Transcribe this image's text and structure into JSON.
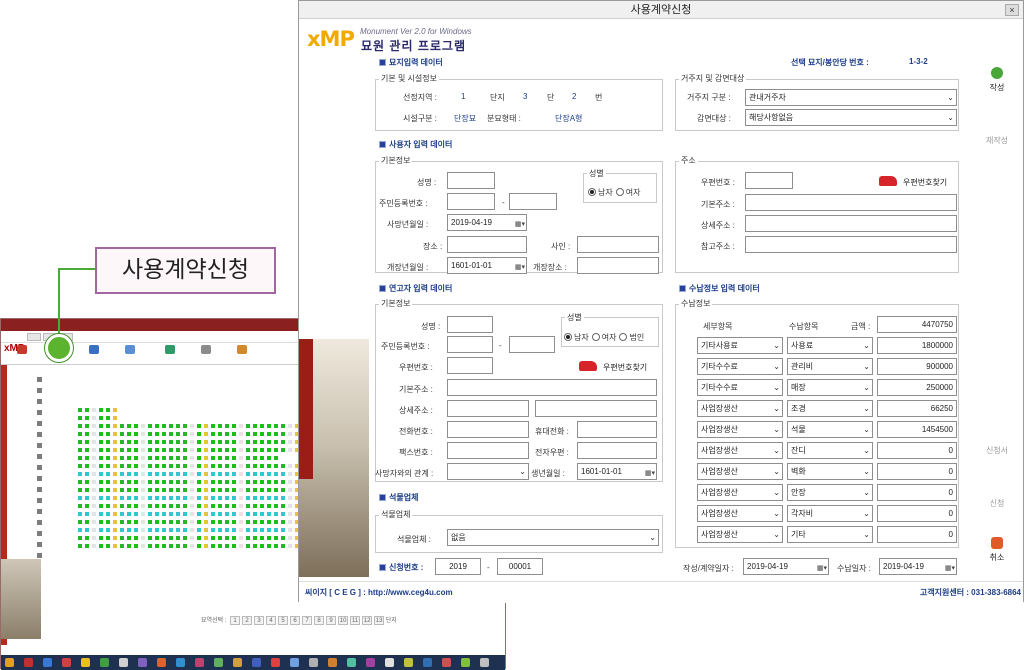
{
  "dialog": {
    "title": "사용계약신청",
    "close_label": "×",
    "brand": {
      "logo": "xMP",
      "version": "Monument Ver 2.0 for Windows",
      "program_name": "묘원 관리 프로그램"
    },
    "selected_grave_label": "선택 묘지/봉안당 번호 :",
    "selected_grave_value": "1-3-2"
  },
  "grave": {
    "section_title": "묘지입력 데이터",
    "facility": {
      "title": "기본 및 시설정보",
      "region_label": "선정지역 :",
      "region_value": "1",
      "danji_label": "단지",
      "danji_value": "3",
      "dan_label": "단",
      "dan_value": "2",
      "bun_label": "번",
      "facility_type_label": "시설구분 :",
      "facility_type_value": "단장묘",
      "burial_type_label": "분묘형태 :",
      "burial_type_value": "단장A형"
    },
    "residency": {
      "title": "거주지 및 감면대상",
      "residence_label": "거주지 구분 :",
      "residence_value": "관내거주자",
      "reduction_label": "감면대상 :",
      "reduction_value": "해당사항없음"
    }
  },
  "user": {
    "section_title": "사용자 입력 데이터",
    "basic": {
      "title": "기본정보",
      "name_label": "성명 :",
      "name_value": "",
      "resident_no_label": "주민등록번호 :",
      "resident_no_dash": "-",
      "gender_title": "성별",
      "male_label": "남자",
      "female_label": "여자",
      "death_date_label": "사망년월일 :",
      "death_date_value": "2019-04-19",
      "funeral_place_label": "장소 :",
      "cause_label": "사인 :",
      "relocation_date_label": "개장년월일 :",
      "relocation_date_value": "1601-01-01",
      "relocation_place_label": "개장장소 :"
    },
    "address": {
      "title": "주소",
      "zip_label": "우편번호 :",
      "zip_button": "우편번호찾기",
      "basic_addr_label": "기본주소 :",
      "detail_addr_label": "상세주소 :",
      "ref_addr_label": "참고주소 :"
    }
  },
  "applicant": {
    "section_title": "연고자 입력 데이터",
    "basic": {
      "title": "기본정보",
      "name_label": "성명 :",
      "resident_no_label": "주민등록번호 :",
      "resident_no_dash": "-",
      "gender_title": "성별",
      "male_label": "남자",
      "female_label": "여자",
      "corp_label": "법인",
      "zip_label": "우편번호 :",
      "zip_button": "우편번호찾기",
      "basic_addr_label": "기본주소 :",
      "detail_addr_label": "상세주소 :",
      "phone_label": "전화번호 :",
      "mobile_label": "휴대전화 :",
      "fax_label": "팩스번호 :",
      "email_label": "전자우편 :",
      "relation_label": "사망자와의 관계 :",
      "relation_value": "",
      "birth_label": "생년월일 :",
      "birth_value": "1601-01-01"
    }
  },
  "stone": {
    "section_title": "석물업체",
    "panel_title": "석물업체",
    "company_label": "석물업체 :",
    "company_value": "없음"
  },
  "payment": {
    "section_title": "수납정보 입력 데이터",
    "panel_title": "수납정보",
    "col_detail": "세부항목",
    "col_item": "수납항목",
    "col_amount": "금액 :",
    "total": "4470750",
    "rows": [
      {
        "detail": "기타사용료",
        "item": "사용료",
        "amount": "1800000"
      },
      {
        "detail": "기타수수료",
        "item": "관리비",
        "amount": "900000"
      },
      {
        "detail": "기타수수료",
        "item": "매장",
        "amount": "250000"
      },
      {
        "detail": "사업장생산",
        "item": "조경",
        "amount": "66250"
      },
      {
        "detail": "사업장생산",
        "item": "석물",
        "amount": "1454500"
      },
      {
        "detail": "사업장생산",
        "item": "잔디",
        "amount": "0"
      },
      {
        "detail": "사업장생산",
        "item": "벽화",
        "amount": "0"
      },
      {
        "detail": "사업장생산",
        "item": "안장",
        "amount": "0"
      },
      {
        "detail": "사업장생산",
        "item": "각자비",
        "amount": "0"
      },
      {
        "detail": "사업장생산",
        "item": "기타",
        "amount": "0"
      }
    ]
  },
  "application_no": {
    "label": "신청번호 :",
    "year": "2019",
    "dash": "-",
    "seq": "00001"
  },
  "dates": {
    "contract_label": "작성/계약일자 :",
    "contract_value": "2019-04-19",
    "receipt_label": "수납일자 :",
    "receipt_value": "2019-04-19"
  },
  "side_buttons": {
    "write": "작성",
    "rewrite": "재작성",
    "application": "신청서",
    "apply": "신청",
    "cancel": "취소"
  },
  "footer": {
    "company": "씨이지 [ C E G ] : http://www.ceg4u.com",
    "support": "고객지원센터 : 031-383-6864"
  },
  "callout": {
    "label": "사용계약신청"
  },
  "background_app": {
    "pager_label": "묘역선택 :",
    "pages": [
      "1",
      "2",
      "3",
      "4",
      "5",
      "6",
      "7",
      "8",
      "9",
      "10",
      "11",
      "12",
      "13"
    ],
    "pager_suffix": "단지"
  },
  "colors": {
    "accent_blue": "#1c3d88",
    "brand_orange": "#f2a900",
    "callout_border": "#a267a0",
    "callout_line": "#4caa38",
    "grid_green": "#1dbb1d",
    "grid_cyan": "#30c7cf"
  }
}
